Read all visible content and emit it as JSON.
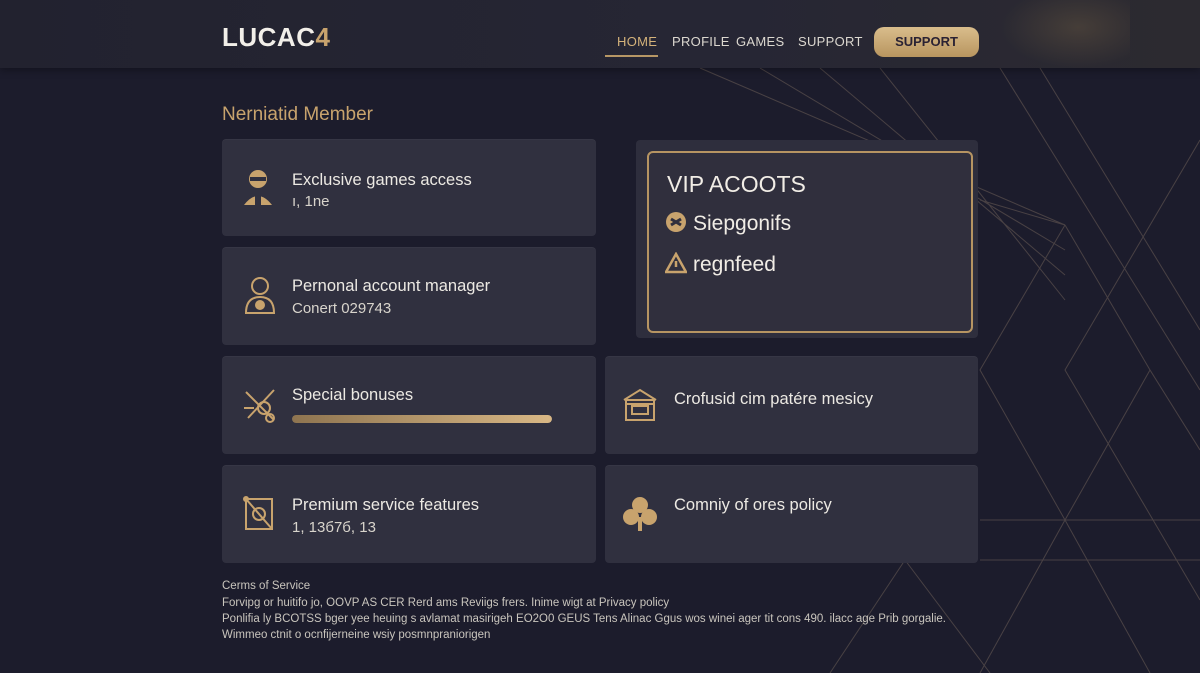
{
  "header": {
    "logo_text": "LUCAC",
    "logo_accent": "4",
    "nav": [
      {
        "label": "HOME",
        "active": true
      },
      {
        "label": "PROFILE",
        "active": false
      },
      {
        "label": "GAMES",
        "active": false
      },
      {
        "label": "SUPPORT",
        "active": false
      }
    ],
    "cta_label": "SUPPORT"
  },
  "section_title": "Nerniatid Member",
  "cards": {
    "exclusive": {
      "title": "Exclusive games access",
      "sub": "ı, 1ne",
      "icon": "user-badge-icon"
    },
    "manager": {
      "title": "Pernonal account manager",
      "sub": "Conert 029743",
      "icon": "person-icon"
    },
    "bonuses": {
      "title": "Special bonuses",
      "progress": 1.0,
      "icon": "scissors-tools-icon"
    },
    "premium": {
      "title": "Premium service features",
      "sub": "1, 13б7б, 13",
      "icon": "frame-icon"
    },
    "policy1": {
      "title": "Crofusid cim patére mesicy",
      "icon": "house-box-icon"
    },
    "policy2": {
      "title": "Comniy of ores policy",
      "icon": "clover-icon"
    }
  },
  "vip": {
    "title": "VIP ACOOTS",
    "rows": [
      {
        "label": "Siepgonifs",
        "icon": "gear-badge-icon"
      },
      {
        "label": "regnfeed",
        "icon": "warning-triangle-icon"
      }
    ]
  },
  "footer": {
    "line1": "Cerms of Service",
    "line2": "Forvipg or huitifo jo, OOVP AS CER Rerd ams Reviigs frers. Inime wigt at Privacy policy",
    "line3": "Ponlifia ly BCOTSS bger yee heuing s avlamat masirigeh EO2O0 GEUS Tens Alinac Ggus wos winei ager tit cons 490. ilacc age Prib gorgalie.",
    "line4": "Wimmeo ctnit o ocnfijerneine wsiy posmnpraniorigen"
  },
  "colors": {
    "background": "#1c1c2c",
    "card": "#30303f",
    "accent_gold": "#c8a36d"
  }
}
